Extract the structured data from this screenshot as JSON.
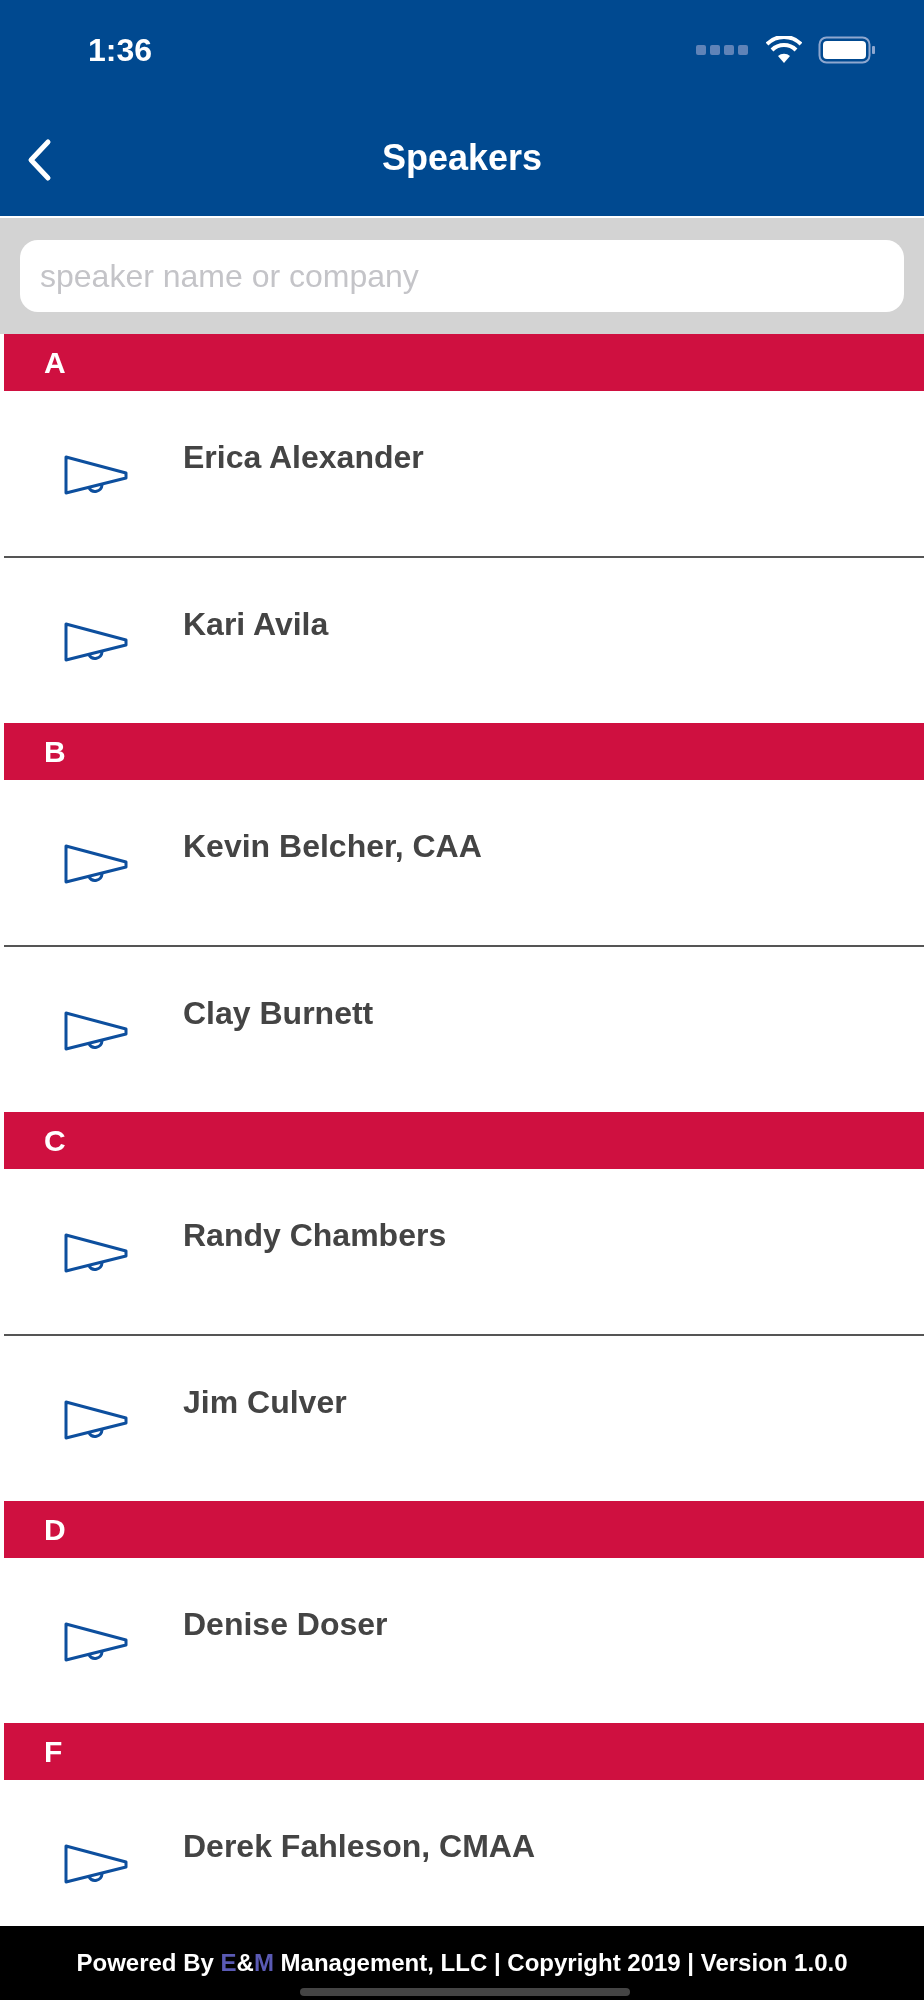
{
  "status_bar": {
    "time": "1:36"
  },
  "nav": {
    "title": "Speakers"
  },
  "search": {
    "placeholder": "speaker name or company"
  },
  "sections": [
    {
      "letter": "A",
      "speakers": [
        {
          "name": "Erica Alexander"
        },
        {
          "name": "Kari Avila"
        }
      ]
    },
    {
      "letter": "B",
      "speakers": [
        {
          "name": "Kevin Belcher, CAA"
        },
        {
          "name": "Clay Burnett"
        }
      ]
    },
    {
      "letter": "C",
      "speakers": [
        {
          "name": "Randy Chambers"
        },
        {
          "name": "Jim Culver"
        }
      ]
    },
    {
      "letter": "D",
      "speakers": [
        {
          "name": "Denise Doser"
        }
      ]
    },
    {
      "letter": "F",
      "speakers": [
        {
          "name": "Derek Fahleson, CMAA"
        }
      ]
    }
  ],
  "footer": {
    "parts": [
      {
        "text": "Powered By ",
        "highlighted": false
      },
      {
        "text": "E",
        "highlighted": true
      },
      {
        "text": "&",
        "highlighted": false
      },
      {
        "text": "M",
        "highlighted": true
      },
      {
        "text": " Management, LLC | Copyright 2019 | Version 1.0.0",
        "highlighted": false
      }
    ]
  }
}
